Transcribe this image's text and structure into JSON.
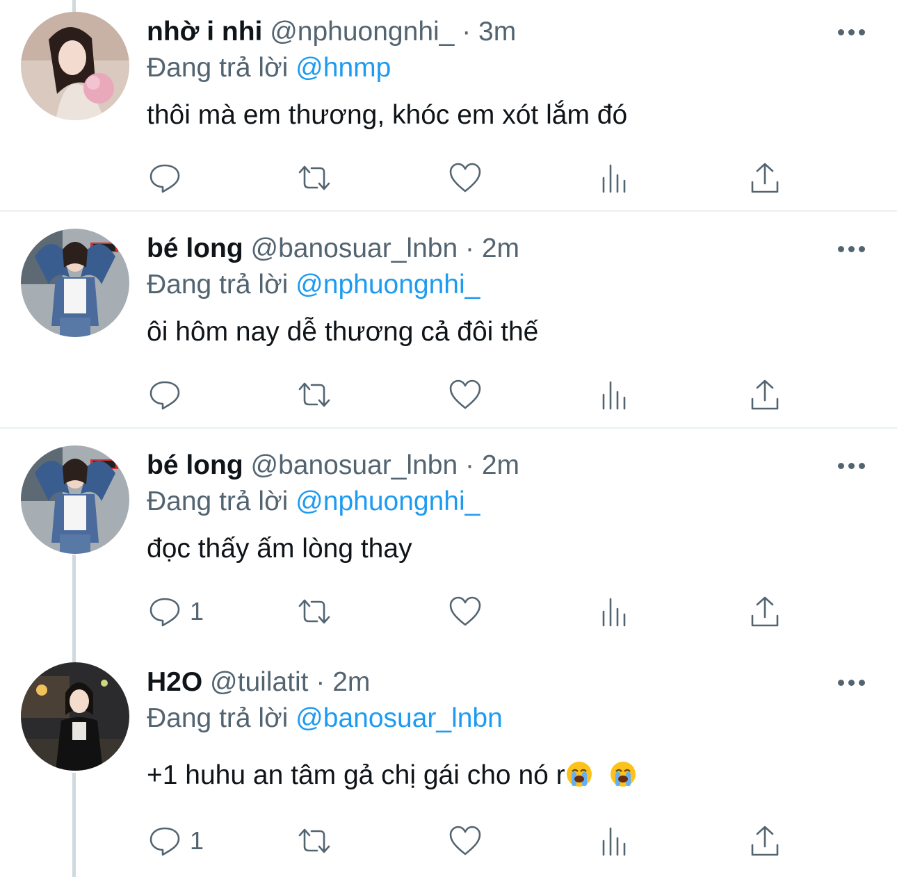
{
  "colors": {
    "accent": "#1d9bf0",
    "muted": "#536471",
    "text": "#0f1419",
    "divider": "#eff3f4"
  },
  "tweets": [
    {
      "name": "nhờ i nhi",
      "handle": "@nphuongnhi_",
      "sep": "·",
      "time": "3m",
      "replying_label": "Đang trả lời",
      "replying_to": "@hnmp",
      "text": "thôi mà em thương, khóc em xót lắm đó",
      "reply_count": "",
      "avatar": "avatar-photo"
    },
    {
      "name": "bé long",
      "handle": "@banosuar_lnbn",
      "sep": "·",
      "time": "2m",
      "replying_label": "Đang trả lời",
      "replying_to": "@nphuongnhi_",
      "text": "ôi hôm nay dễ thương cả đôi thế",
      "reply_count": "",
      "avatar": "avatar-photo"
    },
    {
      "name": "bé long",
      "handle": "@banosuar_lnbn",
      "sep": "·",
      "time": "2m",
      "replying_label": "Đang trả lời",
      "replying_to": "@nphuongnhi_",
      "text": "đọc thấy ấm lòng thay",
      "reply_count": "1",
      "avatar": "avatar-photo"
    },
    {
      "name": "H2O",
      "handle": "@tuilatit",
      "sep": "·",
      "time": "2m",
      "replying_label": "Đang trả lời",
      "replying_to": "@banosuar_lnbn",
      "text": "+1 huhu an tâm gả chị gái cho nó r",
      "emoji": "loudly-crying-face",
      "reply_count": "1",
      "avatar": "avatar-photo"
    }
  ],
  "icons": [
    "reply-icon",
    "retweet-icon",
    "like-icon",
    "views-icon",
    "share-icon",
    "more-icon"
  ]
}
